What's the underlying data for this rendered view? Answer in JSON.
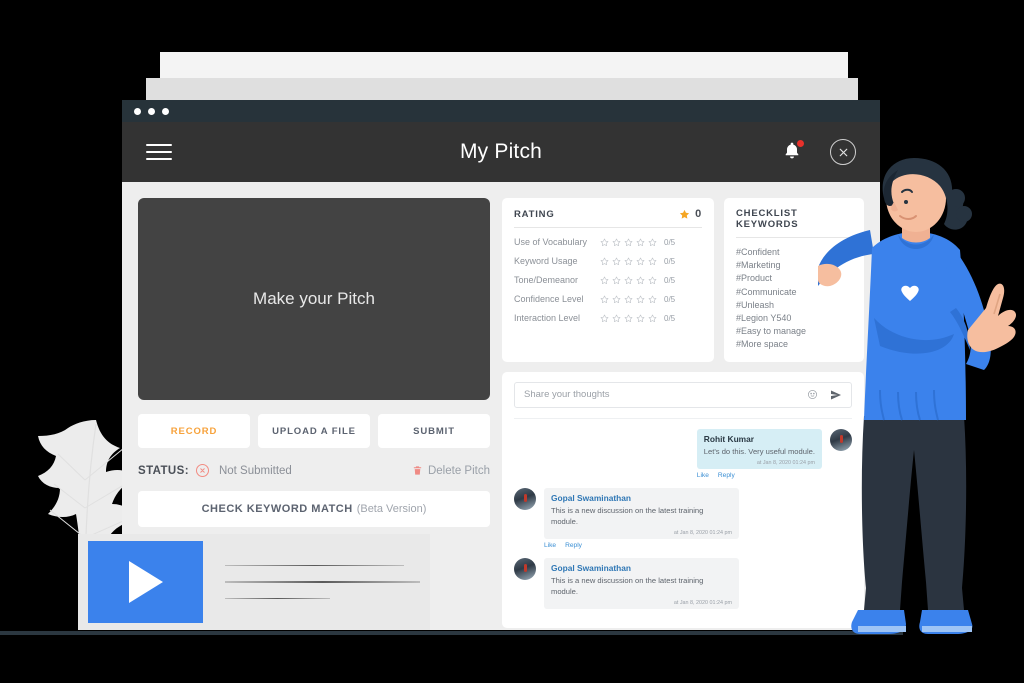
{
  "window": {
    "title": "My Pitch",
    "menu_icon": "hamburger-icon",
    "bell_icon": "bell-icon",
    "close_icon": "close-circle-icon"
  },
  "pitch": {
    "placeholder_text": "Make your Pitch",
    "buttons": [
      {
        "label": "RECORD",
        "accent": true
      },
      {
        "label": "UPLOAD A FILE",
        "accent": false
      },
      {
        "label": "SUBMIT",
        "accent": false
      }
    ],
    "status_label": "STATUS:",
    "status_value": "Not Submitted",
    "delete_label": "Delete Pitch",
    "keyword_match_label": "CHECK KEYWORD MATCH",
    "keyword_match_note": "(Beta Version)"
  },
  "rating": {
    "title": "RATING",
    "score": "0",
    "rows": [
      {
        "name": "Use of Vocabulary",
        "value": 0,
        "frac": "0/5"
      },
      {
        "name": "Keyword Usage",
        "value": 0,
        "frac": "0/5"
      },
      {
        "name": "Tone/Demeanor",
        "value": 0,
        "frac": "0/5"
      },
      {
        "name": "Confidence Level",
        "value": 0,
        "frac": "0/5"
      },
      {
        "name": "Interaction Level",
        "value": 0,
        "frac": "0/5"
      }
    ]
  },
  "keywords": {
    "title": "CHECKLIST KEYWORDS",
    "items": [
      "#Confident",
      "#Marketing",
      "#Product",
      "#Communicate",
      "#Unleash",
      "#Legion Y540",
      "#Easy to manage",
      "#More space"
    ]
  },
  "comments": {
    "input_placeholder": "Share your thoughts",
    "emoji_icon": "emoji-icon",
    "send_icon": "send-icon",
    "items": [
      {
        "author": "Rohit Kumar",
        "text": "Let's do this. Very useful module.",
        "time": "at Jan 8, 2020 01:24 pm",
        "self": true,
        "actions": [
          "Like",
          "Reply"
        ]
      },
      {
        "author": "Gopal Swaminathan",
        "text": "This is a new discussion on the latest training module.",
        "time": "at Jan 8, 2020 01:24 pm",
        "self": false,
        "actions": [
          "Like",
          "Reply"
        ]
      },
      {
        "author": "Gopal Swaminathan",
        "text": "This is a new discussion on the latest training module.",
        "time": "at Jan 8, 2020 01:24 pm",
        "self": false,
        "actions": []
      }
    ]
  },
  "video_card": {
    "play_icon": "play-icon"
  },
  "colors": {
    "accent_orange": "#f7a23b",
    "brand_blue": "#3b82ec",
    "appbar_dark": "#333333",
    "titlebar_dark": "#27333a",
    "star_gold": "#f5a623",
    "danger_red": "#e8312b"
  }
}
